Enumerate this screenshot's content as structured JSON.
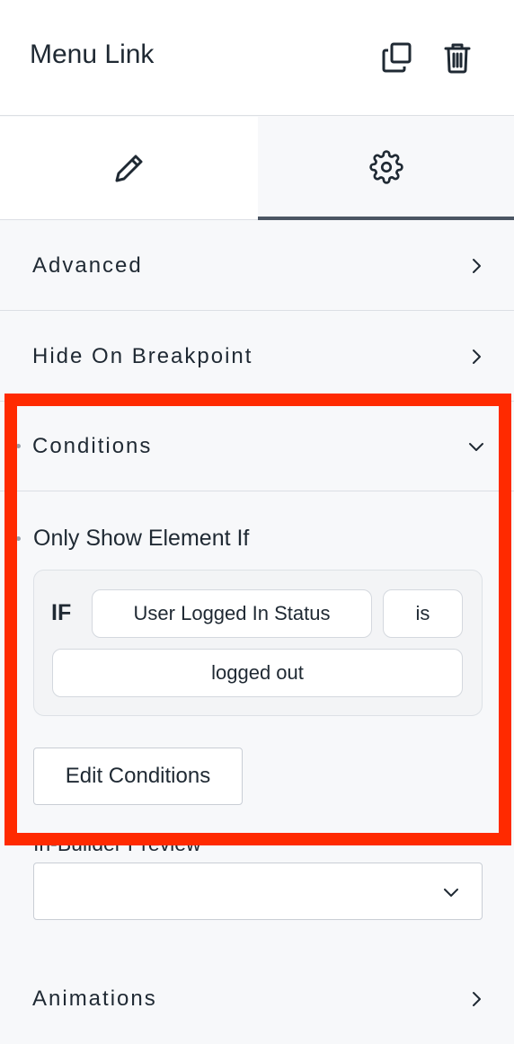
{
  "header": {
    "title": "Menu Link"
  },
  "sections": {
    "advanced": "Advanced",
    "hide_on_breakpoint": "Hide On Breakpoint",
    "conditions": "Conditions",
    "animations": "Animations"
  },
  "conditions": {
    "heading": "Only Show Element If",
    "if_label": "IF",
    "field": "User Logged In Status",
    "operator": "is",
    "value": "logged out",
    "edit_button": "Edit Conditions"
  },
  "preview": {
    "label": "In-Builder Preview",
    "selected": ""
  },
  "colors": {
    "highlight": "#ff2a00",
    "active_tab_indicator": "#4b5563"
  },
  "icons": [
    "copy-icon",
    "trash-icon",
    "pencil-icon",
    "gear-icon",
    "chevron-right-icon",
    "chevron-down-icon"
  ]
}
